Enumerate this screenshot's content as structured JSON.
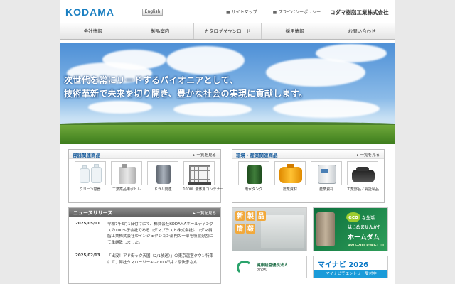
{
  "header": {
    "logo": "KODAMA",
    "english_button": "English",
    "sitemap": "サイトマップ",
    "privacy": "プライバシーポリシー",
    "company": "コダマ樹脂工業株式会社"
  },
  "nav": {
    "items": [
      "会社情報",
      "製品案内",
      "カタログダウンロード",
      "採用情報",
      "お問い合わせ"
    ]
  },
  "hero": {
    "line1": "次世代を常にリードするパイオニアとして、",
    "line2": "技術革新で未来を切り開き、豊かな社会の実現に貢献します。"
  },
  "containers": {
    "title": "容器関連商品",
    "more": "一覧を見る",
    "items": [
      "クリーン容器",
      "工業薬品用ボトル",
      "ドラム関連",
      "1000L 液体用コンテナー"
    ]
  },
  "environment": {
    "title": "環境・産業関連商品",
    "more": "一覧を見る",
    "items": [
      "雨水タンク",
      "農業資材",
      "産業資材",
      "工業部品／受託製品"
    ]
  },
  "news": {
    "title": "ニュースリリース",
    "more": "一覧を見る",
    "items": [
      {
        "date": "2025/05/01",
        "text": "令和7年5月1日付けにて、株式会社KODAMAホールディングスの100%子会社であるコダマプラスト株式会社にコダマ樹脂工業株式会社のインジェクション部門の一部を吸収分割にて承継致しました。"
      },
      {
        "date": "2025/02/13",
        "text": "「出没！アド街ック天国（2/1放送）」の東京温室タウン特集にて、弊社タマローリーAT-2000が井ノ原快彦さん"
      }
    ]
  },
  "banners": {
    "new_products": [
      "新",
      "製",
      "品",
      "情",
      "報"
    ],
    "eco_badge": "eco",
    "eco_line1": "な生活",
    "eco_line2": "はじめませんか？",
    "eco_product": "ホームダム",
    "eco_models": "RWT-200 RWT-110",
    "kenpo_sub": "健康経営優良法人",
    "kenpo_year": "2025",
    "mynavi_logo": "マイナビ",
    "mynavi_year": "2026",
    "mynavi_cta": "マイナビでエントリー受付中"
  }
}
